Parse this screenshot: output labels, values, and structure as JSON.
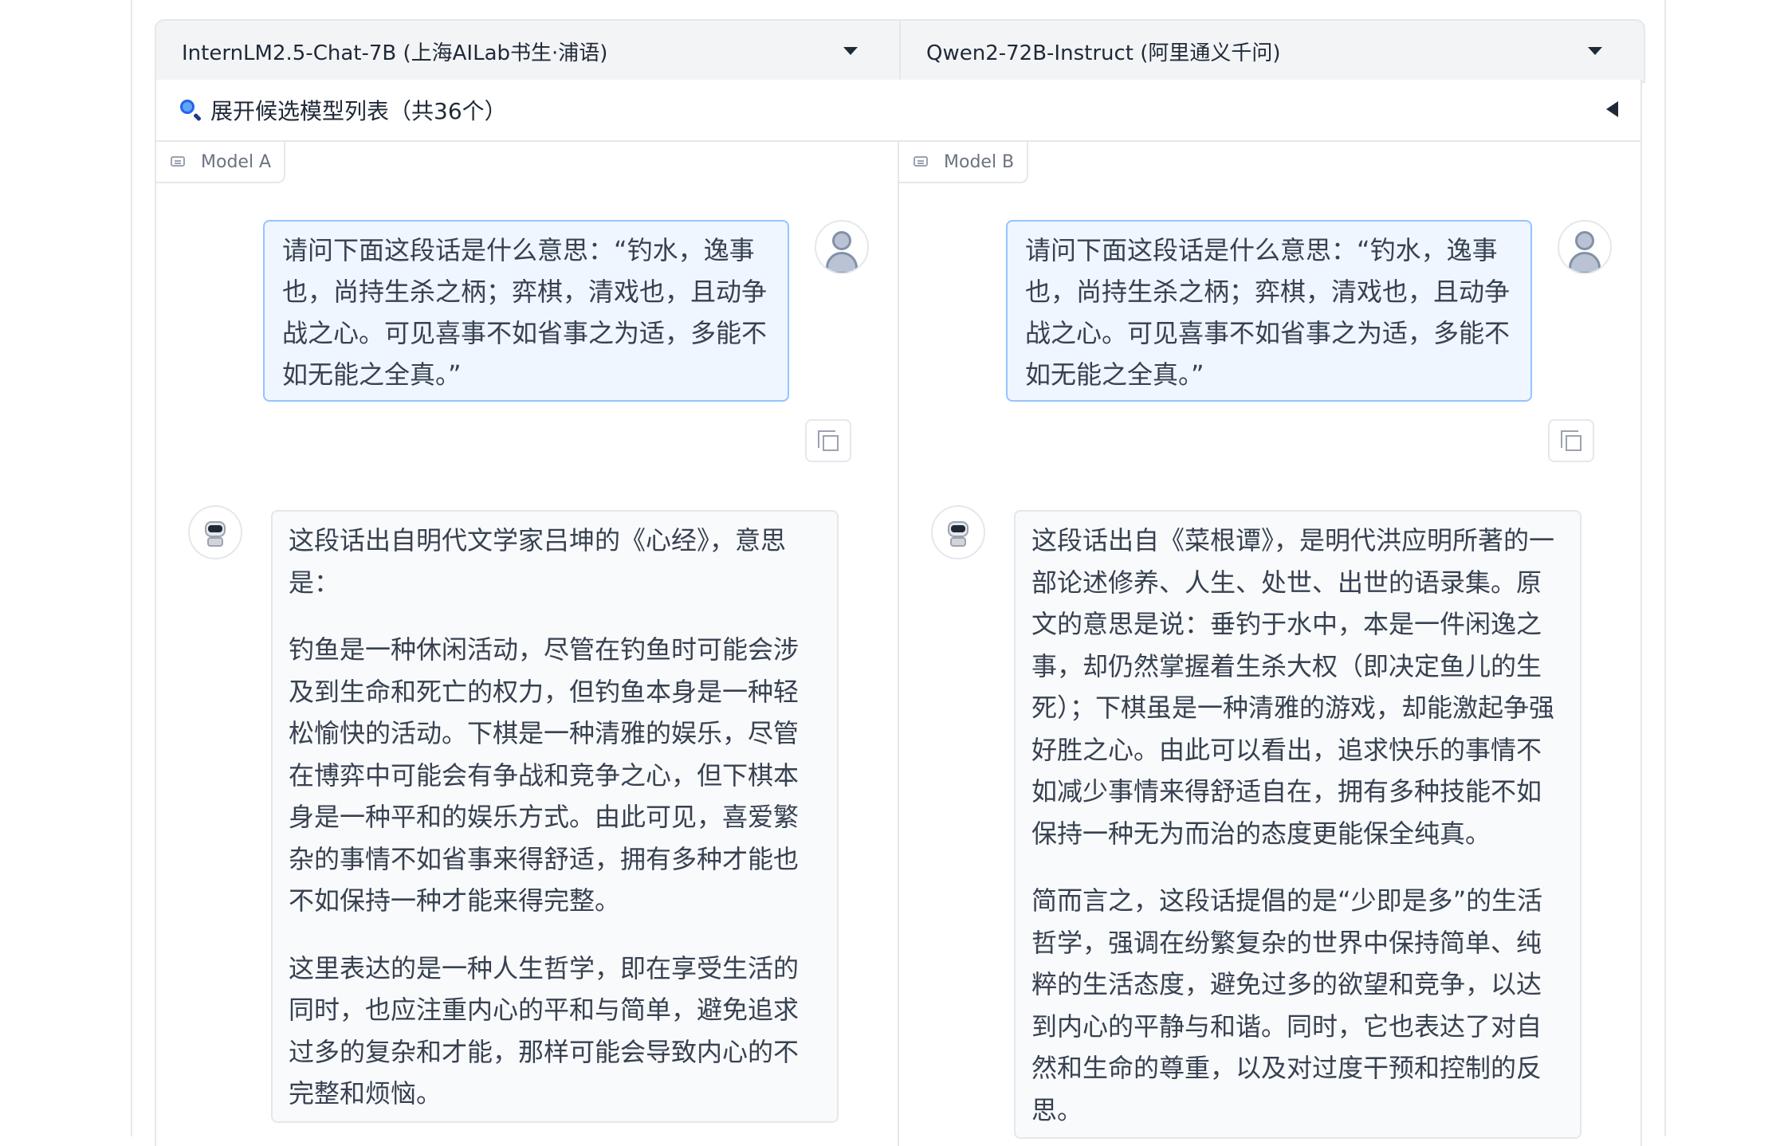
{
  "models": {
    "a": {
      "label": "InternLM2.5-Chat-7B (上海AILab书生·浦语)"
    },
    "b": {
      "label": "Qwen2-72B-Instruct (阿里通义千问)"
    }
  },
  "expander": {
    "label": "展开候选模型列表（共36个）"
  },
  "panel_a": {
    "tag": "Model A",
    "user_message": "请问下面这段话是什么意思：“钓水，逸事也，尚持生杀之柄；弈棋，清戏也，且动争战之心。可见喜事不如省事之为适，多能不如无能之全真。”",
    "bot_paragraphs": [
      "这段话出自明代文学家吕坤的《心经》，意思是：",
      "钓鱼是一种休闲活动，尽管在钓鱼时可能会涉及到生命和死亡的权力，但钓鱼本身是一种轻松愉快的活动。下棋是一种清雅的娱乐，尽管在博弈中可能会有争战和竞争之心，但下棋本身是一种平和的娱乐方式。由此可见，喜爱繁杂的事情不如省事来得舒适，拥有多种才能也不如保持一种才能来得完整。",
      "这里表达的是一种人生哲学，即在享受生活的同时，也应注重内心的平和与简单，避免追求过多的复杂和才能，那样可能会导致内心的不完整和烦恼。"
    ]
  },
  "panel_b": {
    "tag": "Model B",
    "user_message": "请问下面这段话是什么意思：“钓水，逸事也，尚持生杀之柄；弈棋，清戏也，且动争战之心。可见喜事不如省事之为适，多能不如无能之全真。”",
    "bot_paragraphs": [
      "这段话出自《菜根谭》，是明代洪应明所著的一部论述修养、人生、处世、出世的语录集。原文的意思是说：垂钓于水中，本是一件闲逸之事，却仍然掌握着生杀大权（即决定鱼儿的生死）；下棋虽是一种清雅的游戏，却能激起争强好胜之心。由此可以看出，追求快乐的事情不如减少事情来得舒适自在，拥有多种技能不如保持一种无为而治的态度更能保全纯真。",
      "简而言之，这段话提倡的是“少即是多”的生活哲学，强调在纷繁复杂的世界中保持简单、纯粹的生活态度，避免过多的欲望和竞争，以达到内心的平静与和谐。同时，它也表达了对自然和生命的尊重，以及对过度干预和控制的反思。"
    ]
  },
  "icons": [
    "chevron-down-icon",
    "magnifier-icon",
    "collapse-triangle-icon",
    "chat-icon",
    "user-avatar-icon",
    "robot-avatar-icon",
    "copy-icon"
  ]
}
